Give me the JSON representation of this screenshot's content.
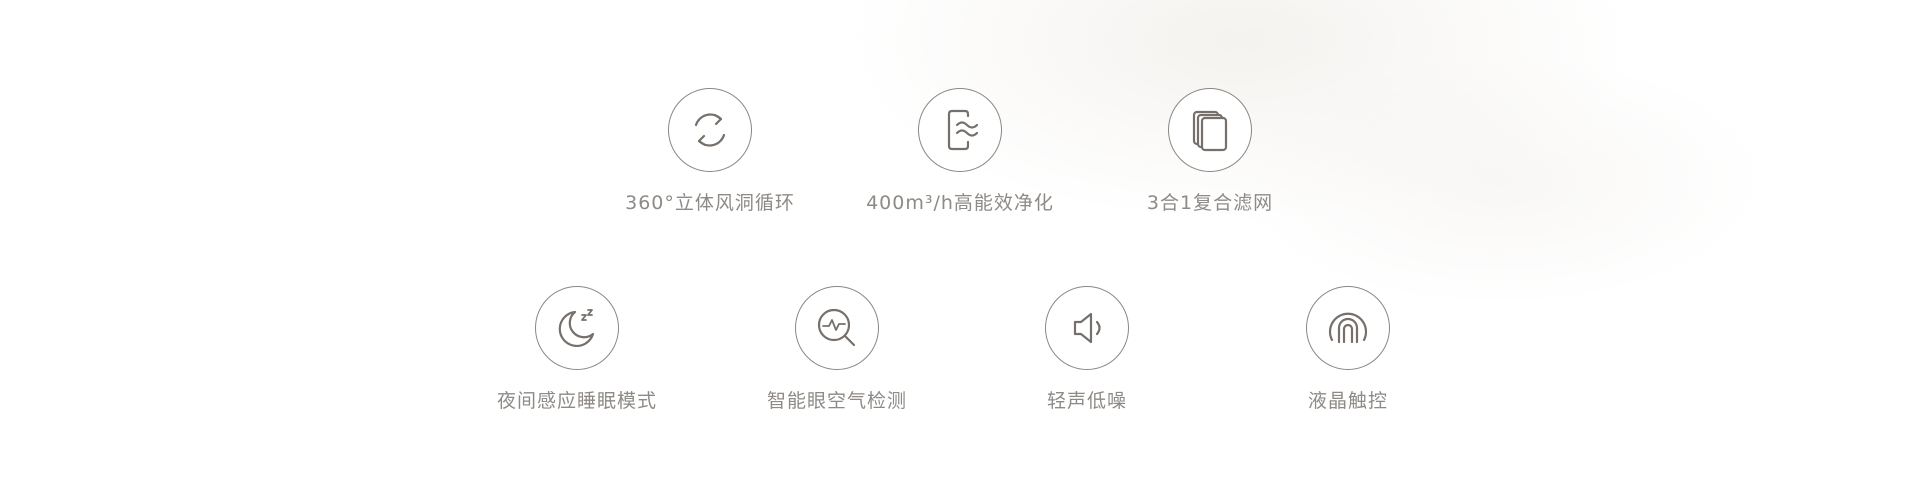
{
  "features": [
    {
      "label": "360°立体风洞循环",
      "icon": "circulation-icon"
    },
    {
      "label": "400m³/h高能效净化",
      "icon": "airflow-filter-icon"
    },
    {
      "label": "3合1复合滤网",
      "icon": "composite-filter-icon"
    },
    {
      "label": "夜间感应睡眠模式",
      "icon": "sleep-moon-icon"
    },
    {
      "label": "智能眼空气检测",
      "icon": "air-detection-icon"
    },
    {
      "label": "轻声低噪",
      "icon": "low-noise-speaker-icon"
    },
    {
      "label": "液晶触控",
      "icon": "touch-control-icon"
    }
  ]
}
